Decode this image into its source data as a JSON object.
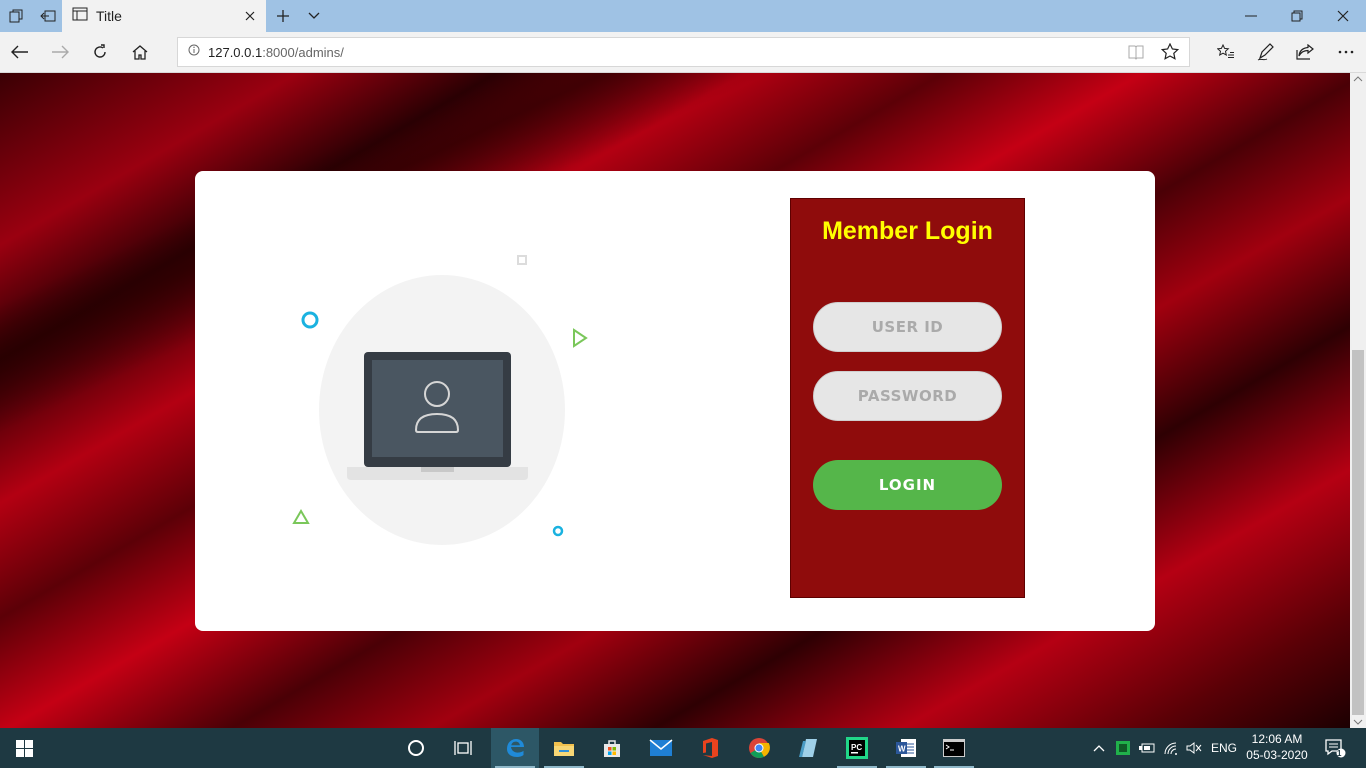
{
  "browser": {
    "tab_title": "Title",
    "url_host": "127.0.0.1",
    "url_rest": ":8000/admins/"
  },
  "login": {
    "title": "Member Login",
    "user_placeholder": "USER ID",
    "password_placeholder": "PASSWORD",
    "button_label": "LOGIN"
  },
  "taskbar": {
    "language": "ENG",
    "time": "12:06 AM",
    "date": "05-03-2020",
    "notification_count": "1"
  },
  "colors": {
    "title": "#ffff00",
    "panel": "#8f0c0c",
    "button": "#55b64a",
    "accent_blue": "#1ab2e0",
    "accent_green": "#7ac75a"
  }
}
